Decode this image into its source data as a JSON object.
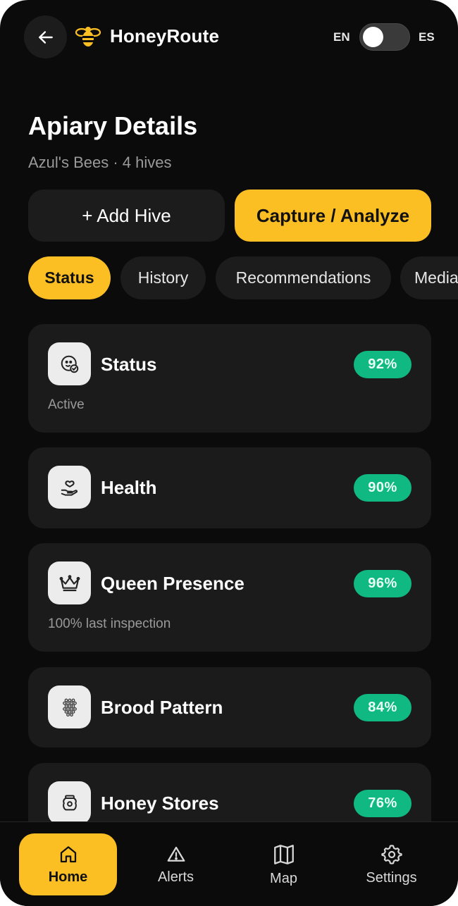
{
  "header": {
    "title": "HoneyRoute",
    "lang_left": "EN",
    "lang_right": "ES",
    "toggle_state": "EN"
  },
  "page": {
    "title": "Apiary Details",
    "subtitle": "Azul's Bees · 4 hives"
  },
  "actions": {
    "add_label": "+ Add Hive",
    "capture_label": "Capture / Analyze"
  },
  "tabs": [
    {
      "label": "Status",
      "active": true
    },
    {
      "label": "History",
      "active": false
    },
    {
      "label": "Recommendations",
      "active": false
    },
    {
      "label": "Media",
      "active": false
    }
  ],
  "cards": [
    {
      "title": "Status",
      "value": "92%",
      "sub": "Active",
      "icon": "face-check-icon"
    },
    {
      "title": "Health",
      "value": "90%",
      "sub": "",
      "icon": "hand-heart-icon"
    },
    {
      "title": "Queen Presence",
      "value": "96%",
      "sub": "100% last inspection",
      "icon": "crown-icon"
    },
    {
      "title": "Brood Pattern",
      "value": "84%",
      "sub": "",
      "icon": "honeycomb-icon"
    },
    {
      "title": "Honey Stores",
      "value": "76%",
      "sub": "",
      "icon": "honey-jar-icon"
    }
  ],
  "nav": [
    {
      "label": "Home",
      "icon": "home-icon",
      "active": true
    },
    {
      "label": "Alerts",
      "icon": "alert-triangle-icon",
      "active": false
    },
    {
      "label": "Map",
      "icon": "map-icon",
      "active": false
    },
    {
      "label": "Settings",
      "icon": "gear-icon",
      "active": false
    }
  ],
  "colors": {
    "background": "#0b0b0b",
    "surface": "#1b1b1b",
    "accent": "#fbbf24",
    "success": "#10b981",
    "muted_text": "#9a9a9a"
  }
}
